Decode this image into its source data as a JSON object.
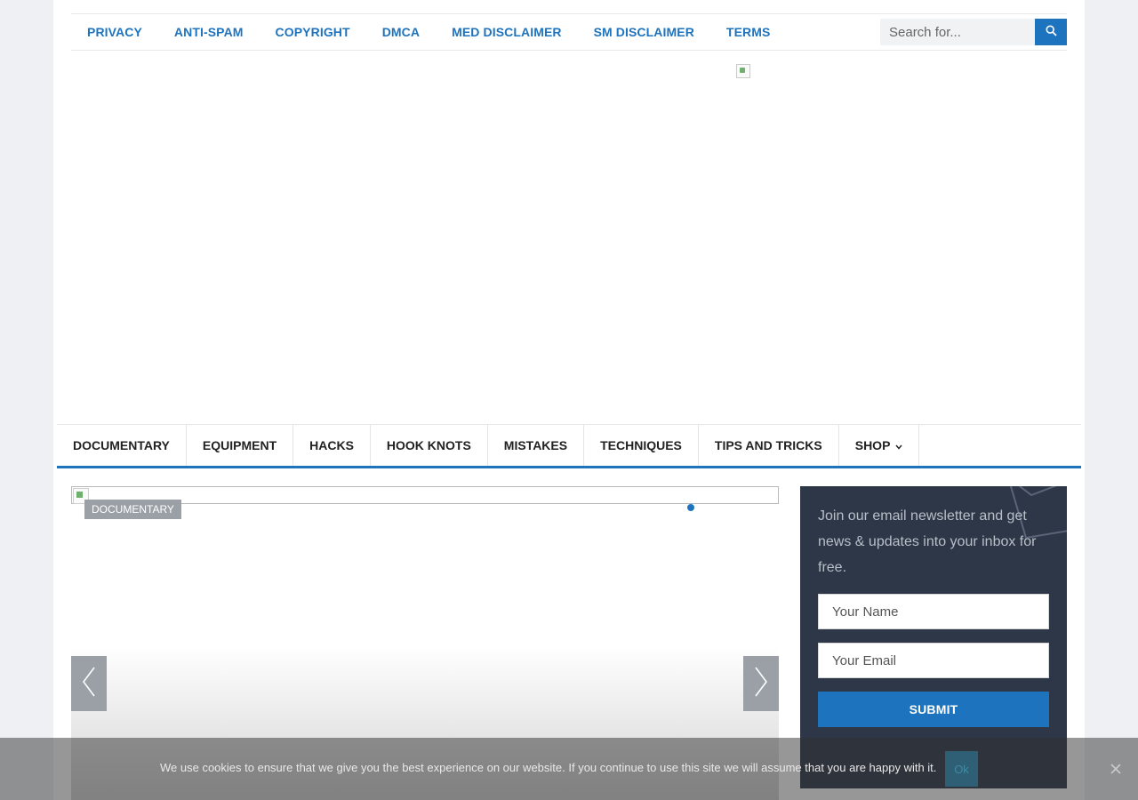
{
  "top_nav": {
    "items": [
      "PRIVACY",
      "ANTI-SPAM",
      "COPYRIGHT",
      "DMCA",
      "MED DISCLAIMER",
      "SM DISCLAIMER",
      "TERMS"
    ]
  },
  "search": {
    "placeholder": "Search for..."
  },
  "main_nav": {
    "items": [
      "DOCUMENTARY",
      "EQUIPMENT",
      "HACKS",
      "HOOK KNOTS",
      "MISTAKES",
      "TECHNIQUES",
      "TIPS AND TRICKS"
    ],
    "shop_label": "SHOP"
  },
  "slider": {
    "category": "DOCUMENTARY"
  },
  "newsletter": {
    "text": "Join our email newsletter and get news & updates into your inbox for free.",
    "name_placeholder": "Your Name",
    "email_placeholder": "Your Email",
    "submit_label": "SUBMIT"
  },
  "cookie": {
    "message": "We use cookies to ensure that we give you the best experience on our website. If you continue to use this site we will assume that you are happy with it.",
    "ok_label": "Ok"
  },
  "colors": {
    "accent": "#1e73be",
    "newsletter_bg": "#2d3748",
    "page_bg": "#eef0f3"
  }
}
